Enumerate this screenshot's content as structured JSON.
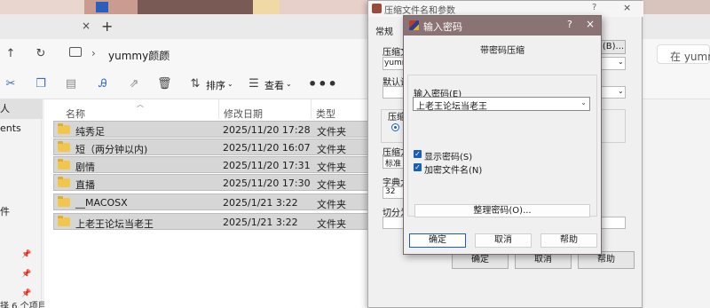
{
  "explorer": {
    "tab_close": "×",
    "tab_add": "+",
    "breadcrumb": {
      "folder": "yummy颜颜",
      "separator": "›"
    },
    "search_placeholder": "在 yummy",
    "toolbar": {
      "sort_label": "排序",
      "view_label": "查看",
      "more": "•••"
    },
    "nav_items": [
      "人",
      "ents",
      "件"
    ],
    "status": "择 6 个项目",
    "columns": {
      "name": "名称",
      "date": "修改日期",
      "type": "类型"
    },
    "rows": [
      {
        "name": "纯秀足",
        "date": "2025/11/20 17:28",
        "type": "文件夹"
      },
      {
        "name": "短（两分钟以内)",
        "date": "2025/11/20 16:07",
        "type": "文件夹"
      },
      {
        "name": "剧情",
        "date": "2025/11/20 17:31",
        "type": "文件夹"
      },
      {
        "name": "直播",
        "date": "2025/11/20 17:30",
        "type": "文件夹"
      },
      {
        "name": "__MACOSX",
        "date": "2025/1/21 3:22",
        "type": "文件夹"
      },
      {
        "name": "上老王论坛当老王",
        "date": "2025/1/21 3:22",
        "type": "文件夹"
      }
    ]
  },
  "archive_dialog": {
    "title": "压缩文件名和参数",
    "help": "?",
    "close": "×",
    "tab_general": "常规",
    "label_filename": "压缩文",
    "filename_value": "yumm",
    "browse_button": "(B)...",
    "label_default": "默认设",
    "label_format": "压缩",
    "label_method": "压缩方",
    "method_value": "标准",
    "label_dict": "字典大",
    "dict_value": "32",
    "label_split": "切分为",
    "ok_button": "确定",
    "cancel_button": "取消",
    "help_button": "帮助"
  },
  "password_dialog": {
    "title": "输入密码",
    "help": "?",
    "close": "×",
    "heading": "带密码压缩",
    "password_label": "输入密码(E)",
    "password_value": "上老王论坛当老王",
    "show_password_label": "显示密码(S)",
    "show_password_checked": true,
    "encrypt_filenames_label": "加密文件名(N)",
    "encrypt_filenames_checked": true,
    "check_glyph": "✓",
    "manage_button": "整理密码(O)...",
    "ok_button": "确定",
    "cancel_button": "取消",
    "help_button": "帮助"
  }
}
